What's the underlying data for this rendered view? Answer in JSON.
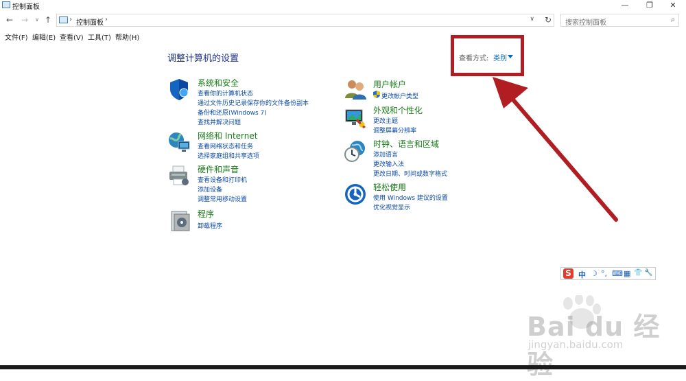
{
  "window": {
    "title": "控制面板"
  },
  "window_buttons": {
    "minimize": "—",
    "maximize": "❐",
    "close": "✕"
  },
  "nav": {
    "back": "←",
    "forward": "→",
    "up": "↑"
  },
  "address": {
    "crumb": "控制面板",
    "arrow1": "›",
    "arrow2": "›",
    "dropdown": "∨",
    "refresh": "↻"
  },
  "search": {
    "placeholder": "搜索控制面板",
    "icon": "⌕"
  },
  "menu": [
    "文件(F)",
    "编辑(E)",
    "查看(V)",
    "工具(T)",
    "帮助(H)"
  ],
  "heading": "调整计算机的设置",
  "view_by": {
    "label": "查看方式:",
    "value": "类别"
  },
  "categories_left": [
    {
      "title": "系统和安全",
      "icon": "shield-icon",
      "links": [
        "查看你的计算机状态",
        "通过文件历史记录保存你的文件备份副本",
        "备份和还原(Windows 7)",
        "查找并解决问题"
      ]
    },
    {
      "title": "网络和 Internet",
      "icon": "network-globe-icon",
      "links": [
        "查看网络状态和任务",
        "选择家庭组和共享选项"
      ]
    },
    {
      "title": "硬件和声音",
      "icon": "printer-icon",
      "links": [
        "查看设备和打印机",
        "添加设备",
        "调整常用移动设置"
      ]
    },
    {
      "title": "程序",
      "icon": "programs-icon",
      "links": [
        "卸载程序"
      ]
    }
  ],
  "categories_right": [
    {
      "title": "用户帐户",
      "icon": "users-icon",
      "links": [
        "更改帐户类型"
      ]
    },
    {
      "title": "外观和个性化",
      "icon": "appearance-icon",
      "links": [
        "更改主题",
        "调整屏幕分辨率"
      ]
    },
    {
      "title": "时钟、语言和区域",
      "icon": "clock-globe-icon",
      "links": [
        "添加语言",
        "更改输入法",
        "更改日期、时间或数字格式"
      ]
    },
    {
      "title": "轻松使用",
      "icon": "ease-of-access-icon",
      "links": [
        "使用 Windows 建议的设置",
        "优化视觉显示"
      ]
    }
  ],
  "ime_toolbar": {
    "logo": "S",
    "mode": "中",
    "moon": "☽",
    "punct": "°,",
    "keyboard": "⌨",
    "grid": "▦",
    "shirt": "👕",
    "wrench": "🔧"
  },
  "watermark": {
    "brand": "Bai du 经验",
    "url": "jingyan.baidu.com"
  },
  "colors": {
    "annotation_red": "#b01e23",
    "link_blue": "#0b4aa6",
    "category_green": "#1a7d1a",
    "heading_blue": "#1e3287"
  }
}
